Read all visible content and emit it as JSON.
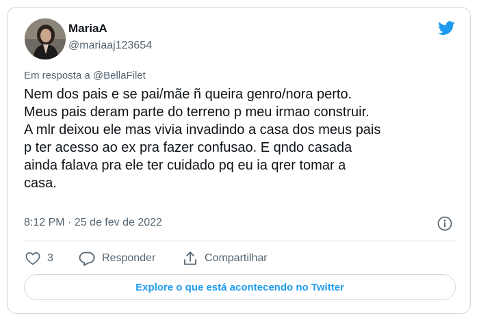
{
  "tweet": {
    "author": {
      "name": "MariaA",
      "handle": "@mariaaj123654"
    },
    "reply_prefix": "Em resposta a",
    "reply_mention": "@BellaFilet",
    "text": "Nem dos pais e se pai/mãe ñ queira genro/nora perto.\nMeus pais deram parte do terreno p meu irmao construir.\nA mlr deixou ele mas vivia invadindo a casa dos meus pais\np ter acesso ao ex pra fazer confusao. E qndo casada\nainda falava pra ele ter cuidado pq eu ia qrer tomar a\ncasa.",
    "timestamp": "8:12 PM · 25 de fev de 2022"
  },
  "actions": {
    "like_count": "3",
    "reply_label": "Responder",
    "share_label": "Compartilhar"
  },
  "explore_label": "Explore o que está acontecendo no Twitter",
  "colors": {
    "brand": "#1d9bf0",
    "text": "#0f1419",
    "secondary": "#536471",
    "border": "#cfd9de"
  },
  "icons": [
    "twitter-bird-icon",
    "info-icon",
    "heart-icon",
    "reply-bubble-icon",
    "share-icon"
  ]
}
